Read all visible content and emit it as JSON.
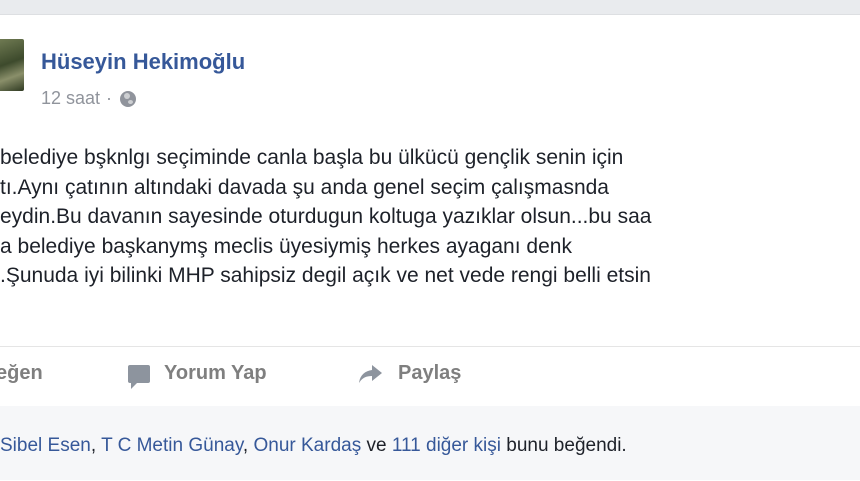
{
  "post": {
    "author": "Hüseyin Hekimoğlu",
    "time": "12 saat",
    "separator": "·",
    "privacy_icon": "globe-icon",
    "lines": [
      " belediye bşknlgı seçiminde canla başla bu ülkücü gençlik senin için",
      "tı.Aynı çatının altındaki davada şu anda genel seçim çalışmasnda",
      "eydin.Bu davanın sayesinde oturdugun koltuga yazıklar olsun...bu saa",
      "a belediye başkanymş meclis üyesiymiş herkes ayaganı denk",
      ".Şunuda iyi bilinki MHP sahipsiz degil açık ve net vede rengi belli etsin"
    ]
  },
  "actions": {
    "like_label": "eğen",
    "comment_label": "Yorum Yap",
    "share_label": "Paylaş"
  },
  "likes": {
    "names": [
      "Sibel Esen",
      "T C Metin Günay",
      "Onur Kardaş"
    ],
    "sep1": ", ",
    "sep2": ", ",
    "conj": " ve ",
    "others": "111 diğer kişi",
    "suffix": " bunu beğendi."
  },
  "colors": {
    "link": "#365899",
    "text": "#1d2129",
    "muted": "#90949c",
    "action": "#7f7f7f"
  }
}
